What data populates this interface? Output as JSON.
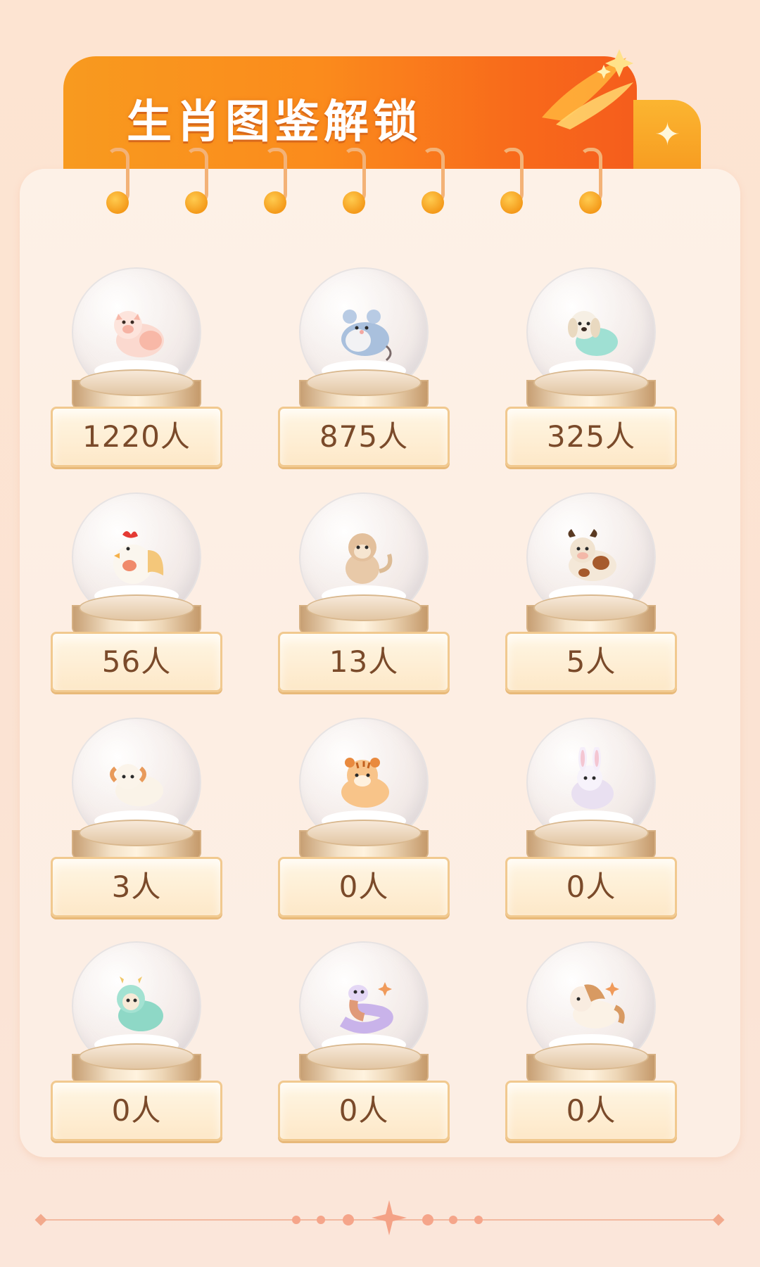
{
  "header": {
    "title": "生肖图鉴解锁"
  },
  "zodiac": [
    {
      "animal": "pig",
      "count": "1220人"
    },
    {
      "animal": "rat",
      "count": "875人"
    },
    {
      "animal": "dog",
      "count": "325人"
    },
    {
      "animal": "rooster",
      "count": "56人"
    },
    {
      "animal": "monkey",
      "count": "13人"
    },
    {
      "animal": "ox",
      "count": "5人"
    },
    {
      "animal": "goat",
      "count": "3人"
    },
    {
      "animal": "tiger",
      "count": "0人"
    },
    {
      "animal": "rabbit",
      "count": "0人"
    },
    {
      "animal": "dragon",
      "count": "0人"
    },
    {
      "animal": "snake",
      "count": "0人"
    },
    {
      "animal": "horse",
      "count": "0人"
    }
  ],
  "colors": {
    "accent": "#f8691b",
    "banner_start": "#f89a1f",
    "label_text": "#7a4a2a",
    "background": "#fde4d2"
  },
  "icons": [
    "sparkle-icon",
    "streak-decoration-icon",
    "ring-binder-icon",
    "divider-star-icon"
  ]
}
